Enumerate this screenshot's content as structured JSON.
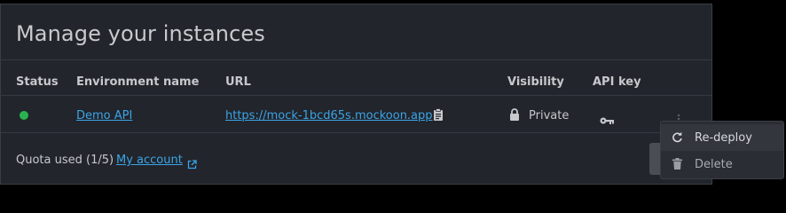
{
  "modal": {
    "title": "Manage your instances"
  },
  "table": {
    "headers": [
      "Status",
      "Environment name",
      "URL",
      "Visibility",
      "API key"
    ],
    "rows": [
      {
        "status_color": "#29b24f",
        "environment_name": "Demo API",
        "url": "https://mock-1bcd65s.mockoon.app",
        "visibility": "Private"
      }
    ]
  },
  "footer": {
    "quota_text": "Quota used (1/5)",
    "account_link": "My account"
  },
  "context_menu": {
    "items": [
      {
        "label": "Re-deploy",
        "icon": "redo-icon"
      },
      {
        "label": "Delete",
        "icon": "trash-icon"
      }
    ]
  },
  "colors": {
    "accent_link": "#3ba4e8",
    "status_green": "#29b24f",
    "modal_bg": "#22252b"
  }
}
